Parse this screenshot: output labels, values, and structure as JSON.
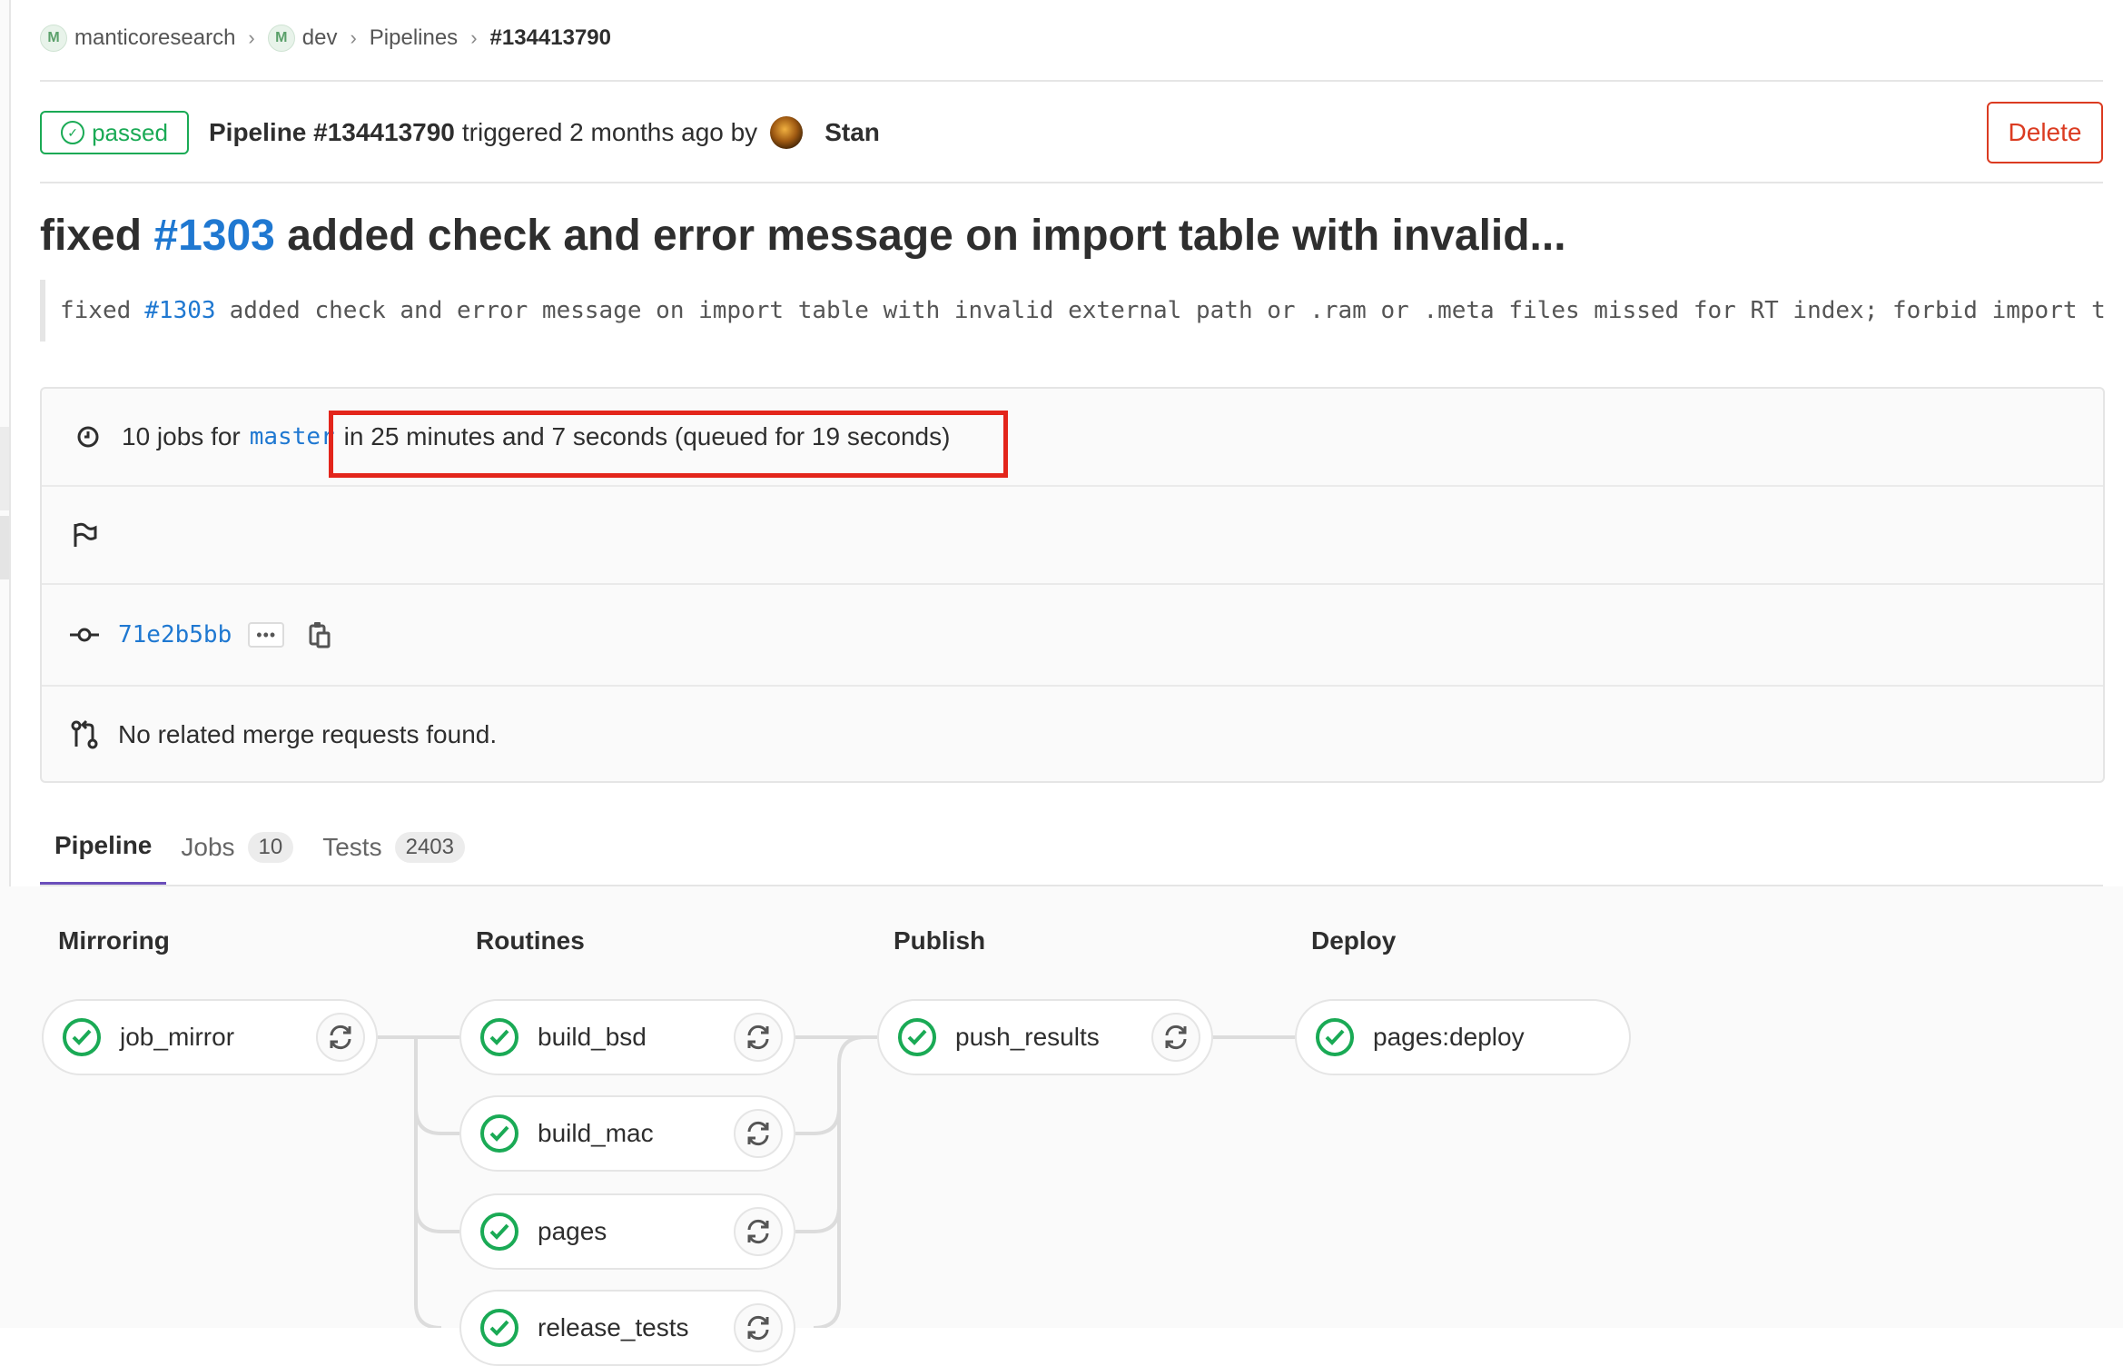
{
  "breadcrumb": {
    "items": [
      {
        "label": "manticoresearch",
        "avatar": "M"
      },
      {
        "label": "dev",
        "avatar": "M"
      },
      {
        "label": "Pipelines"
      },
      {
        "label": "#134413790"
      }
    ]
  },
  "header": {
    "status": "passed",
    "pipeline_label": "Pipeline #134413790",
    "triggered_text": "triggered 2 months ago by",
    "user": "Stan",
    "delete_label": "Delete"
  },
  "commit": {
    "title_prefix": "fixed",
    "title_issue": "#1303",
    "title_rest": "added check and error message on import table with invalid...",
    "desc_prefix": "fixed",
    "desc_issue": "#1303",
    "desc_rest": "added check and error message on import table with invalid external path or .ram or .meta files missed for RT index; forbid import t"
  },
  "info": {
    "jobs_prefix": "10 jobs for",
    "branch": "master",
    "duration_text": "in 25 minutes and 7 seconds (queued for 19 seconds)",
    "commit_sha": "71e2b5bb",
    "merge_text": "No related merge requests found."
  },
  "tabs": [
    {
      "label": "Pipeline",
      "count": null
    },
    {
      "label": "Jobs",
      "count": "10"
    },
    {
      "label": "Tests",
      "count": "2403"
    }
  ],
  "stages": [
    {
      "title": "Mirroring",
      "jobs": [
        "job_mirror"
      ]
    },
    {
      "title": "Routines",
      "jobs": [
        "build_bsd",
        "build_mac",
        "pages",
        "release_tests"
      ]
    },
    {
      "title": "Publish",
      "jobs": [
        "push_results"
      ]
    },
    {
      "title": "Deploy",
      "jobs": [
        "pages:deploy"
      ]
    }
  ],
  "colors": {
    "success": "#1aaa55",
    "danger": "#db3b21",
    "link": "#1f78d1",
    "tab_active": "#6b4fbb",
    "highlight": "#e3251b"
  },
  "icons": [
    "clock-icon",
    "flag-icon",
    "commit-icon",
    "copy-icon",
    "merge-request-icon",
    "status-success-icon",
    "retry-icon"
  ]
}
